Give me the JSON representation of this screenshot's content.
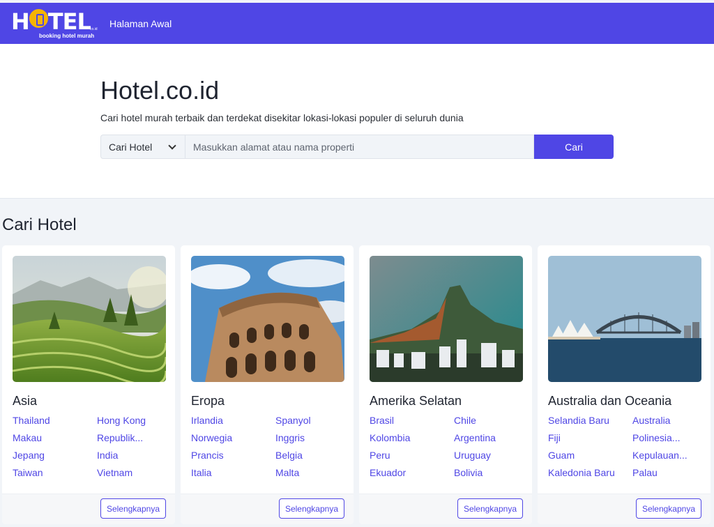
{
  "navbar": {
    "logo_text": "H",
    "logo_text_end": "TEL",
    "logo_small": "co.id",
    "logo_tagline": "booking hotel murah",
    "nav_home": "Halaman Awal"
  },
  "hero": {
    "title": "Hotel.co.id",
    "subtitle": "Cari hotel murah terbaik dan terdekat disekitar lokasi-lokasi populer di seluruh dunia",
    "select_value": "Cari Hotel",
    "input_placeholder": "Masukkan alamat atau nama properti",
    "search_button": "Cari"
  },
  "section": {
    "title": "Cari Hotel"
  },
  "regions": [
    {
      "name": "Asia",
      "countries": [
        "Thailand",
        "Hong Kong",
        "Makau",
        "Republik...",
        "Jepang",
        "India",
        "Taiwan",
        "Vietnam"
      ],
      "more_label": "Selengkapnya"
    },
    {
      "name": "Eropa",
      "countries": [
        "Irlandia",
        "Spanyol",
        "Norwegia",
        "Inggris",
        "Prancis",
        "Belgia",
        "Italia",
        "Malta"
      ],
      "more_label": "Selengkapnya"
    },
    {
      "name": "Amerika Selatan",
      "countries": [
        "Brasil",
        "Chile",
        "Kolombia",
        "Argentina",
        "Peru",
        "Uruguay",
        "Ekuador",
        "Bolivia"
      ],
      "more_label": "Selengkapnya"
    },
    {
      "name": "Australia dan Oceania",
      "countries": [
        "Selandia Baru",
        "Australia",
        "Fiji",
        "Polinesia...",
        "Guam",
        "Kepulauan...",
        "Kaledonia Baru",
        "Palau"
      ],
      "more_label": "Selengkapnya"
    }
  ],
  "colors": {
    "brand": "#4f46e5",
    "logo_accent": "#f5b400",
    "page_bg": "#f1f4f8"
  },
  "icons": {
    "select_chevron": "chevron-down-icon"
  }
}
